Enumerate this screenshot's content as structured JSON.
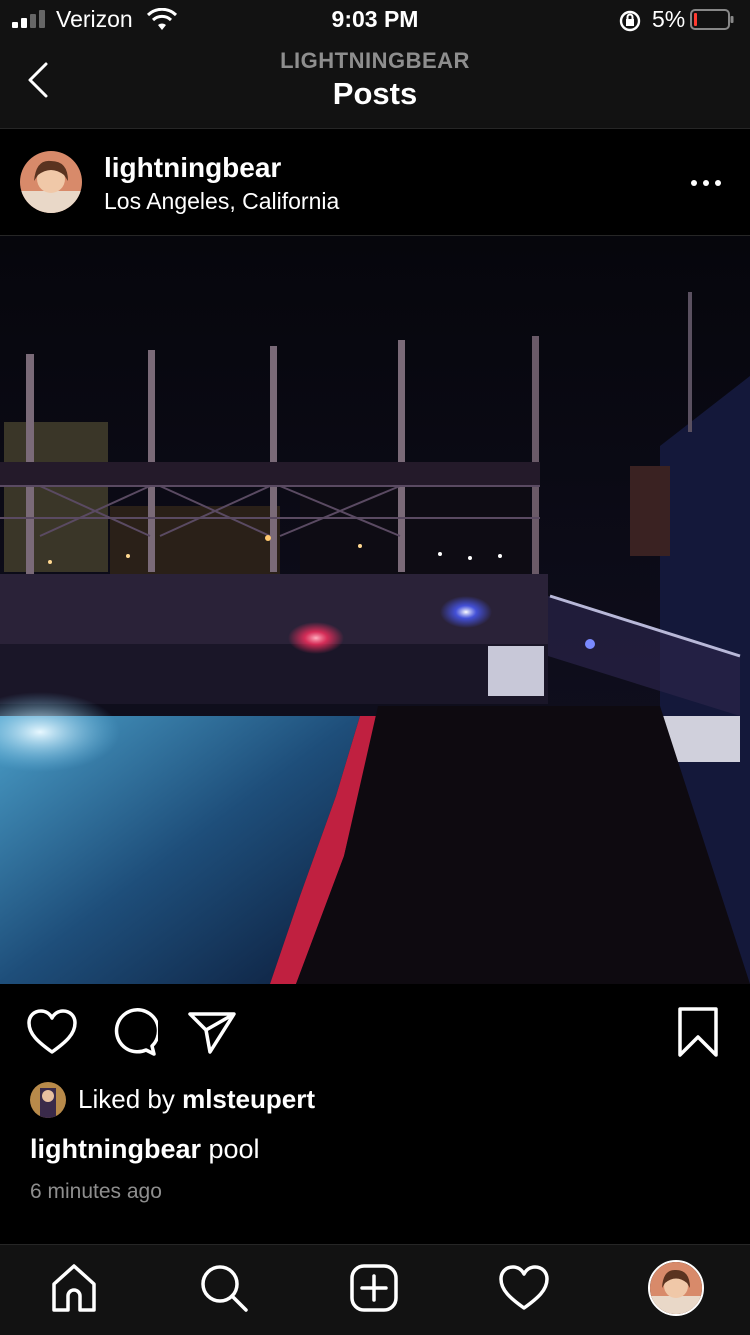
{
  "status_bar": {
    "carrier": "Verizon",
    "time": "9:03 PM",
    "battery_percent": "5%"
  },
  "nav": {
    "username": "LIGHTNINGBEAR",
    "title": "Posts"
  },
  "post": {
    "username": "lightningbear",
    "location": "Los Angeles, California",
    "liked_by_prefix": "Liked by ",
    "liked_by_user": "mlsteupert",
    "caption_user": "lightningbear",
    "caption_text": " pool",
    "time_ago": "6 minutes ago"
  },
  "icons": {
    "back": "back-chevron-icon",
    "more": "more-horizontal-icon",
    "like": "heart-icon",
    "comment": "comment-icon",
    "share": "paper-plane-icon",
    "save": "bookmark-icon",
    "home": "home-icon",
    "search": "search-icon",
    "new_post": "plus-square-icon",
    "activity": "heart-icon"
  },
  "colors": {
    "background": "#000000",
    "bar_background": "#121212",
    "secondary_text": "#8e8e8e",
    "battery_low": "#ff3b30"
  }
}
